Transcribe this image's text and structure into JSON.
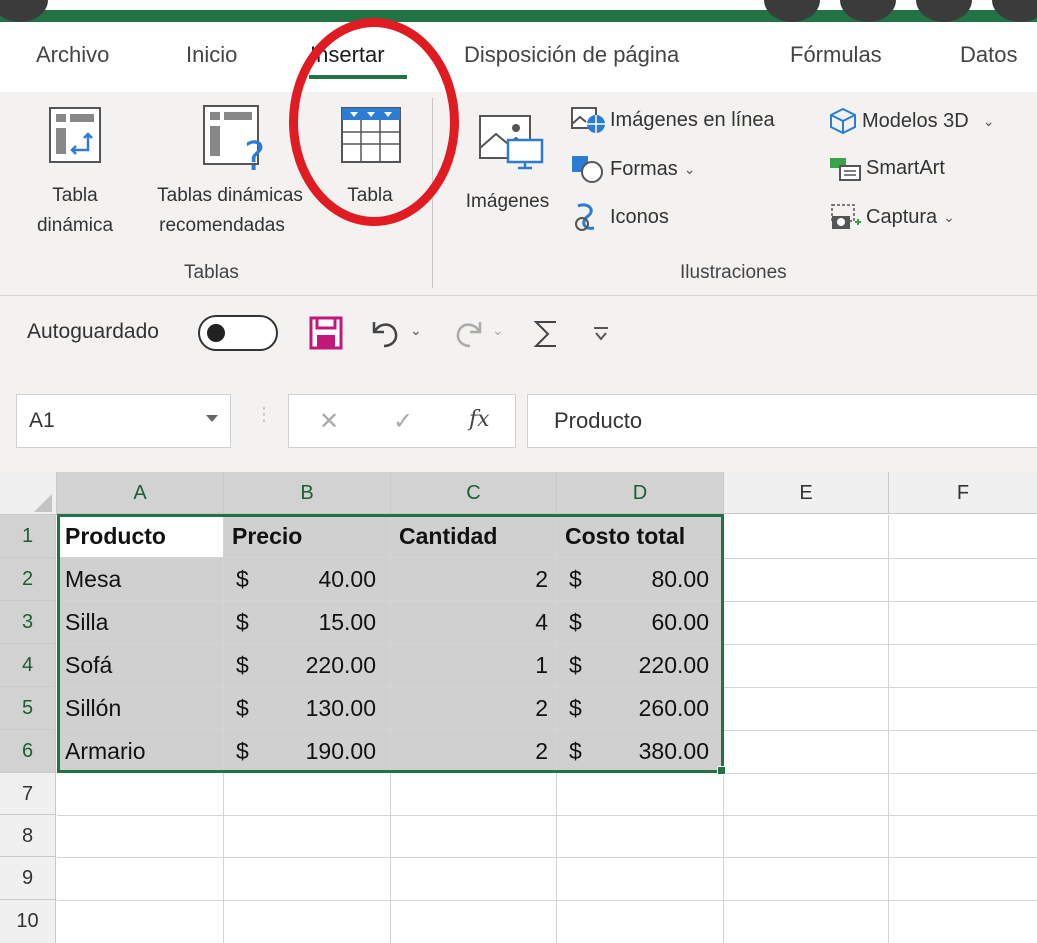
{
  "tabs": [
    "Archivo",
    "Inicio",
    "Insertar",
    "Disposición de página",
    "Fórmulas",
    "Datos"
  ],
  "active_tab": "Insertar",
  "ribbon": {
    "tablas_group": {
      "label": "Tablas",
      "tabla_dinamica": [
        "Tabla",
        "dinámica"
      ],
      "tablas_recomendadas": [
        "Tablas dinámicas",
        "recomendadas"
      ],
      "tabla": "Tabla"
    },
    "ilustraciones_group": {
      "label": "Ilustraciones",
      "imagenes": "Imágenes",
      "imagenes_en_linea": "Imágenes en línea",
      "formas": "Formas",
      "iconos": "Iconos",
      "modelos_3d": "Modelos 3D",
      "smartart": "SmartArt",
      "captura": "Captura"
    }
  },
  "qat": {
    "autosave_label": "Autoguardado"
  },
  "formula_bar": {
    "name_box": "A1",
    "fx": "fx",
    "value": "Producto"
  },
  "columns": [
    "A",
    "B",
    "C",
    "D",
    "E",
    "F"
  ],
  "rows": [
    "1",
    "2",
    "3",
    "4",
    "5",
    "6",
    "7",
    "8",
    "9",
    "10"
  ],
  "currency_symbol": "$",
  "table": {
    "headers": [
      "Producto",
      "Precio",
      "Cantidad",
      "Costo total"
    ],
    "rows": [
      {
        "producto": "Mesa",
        "precio": "40.00",
        "cantidad": "2",
        "costo": "80.00"
      },
      {
        "producto": "Silla",
        "precio": "15.00",
        "cantidad": "4",
        "costo": "60.00"
      },
      {
        "producto": "Sofá",
        "precio": "220.00",
        "cantidad": "1",
        "costo": "220.00"
      },
      {
        "producto": "Sillón",
        "precio": "130.00",
        "cantidad": "2",
        "costo": "260.00"
      },
      {
        "producto": "Armario",
        "precio": "190.00",
        "cantidad": "2",
        "costo": "380.00"
      }
    ]
  },
  "colors": {
    "excel_green": "#217346",
    "annotation_red": "#e01b22",
    "save_icon": "#c2187a"
  }
}
